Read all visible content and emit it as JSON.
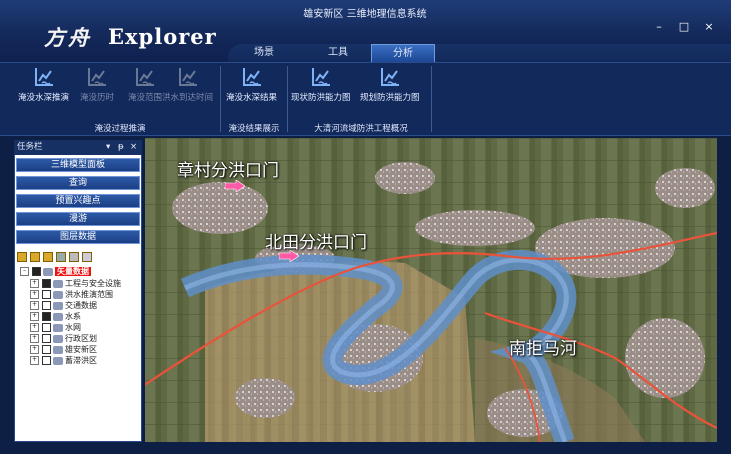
{
  "window": {
    "logo_mark": "方舟",
    "logo_word": "Explorer",
    "title": "雄安新区 三维地理信息系统",
    "controls": [
      "–",
      "□",
      "×"
    ]
  },
  "tabs": [
    {
      "label": "场景",
      "active": false
    },
    {
      "label": "工具",
      "active": false
    },
    {
      "label": "分析",
      "active": true
    }
  ],
  "ribbon": {
    "groups": [
      {
        "label": "淹没过程推演",
        "buttons": [
          {
            "label": "淹没水深推演",
            "enabled": true,
            "icon": "flood-chart-icon"
          },
          {
            "label": "淹没历时",
            "enabled": false,
            "icon": "flood-chart-icon"
          },
          {
            "label": "淹没范围",
            "enabled": false,
            "icon": "flood-chart-icon"
          },
          {
            "label": "洪水到达时间",
            "enabled": false,
            "icon": "flood-chart-icon"
          }
        ]
      },
      {
        "label": "淹没结果展示",
        "buttons": [
          {
            "label": "淹没水深结果",
            "enabled": true,
            "icon": "flood-chart-icon"
          }
        ]
      },
      {
        "label": "大清河流域防洪工程概况",
        "buttons": [
          {
            "label": "现状防洪能力图",
            "enabled": true,
            "icon": "flood-chart-icon"
          },
          {
            "label": "规划防洪能力图",
            "enabled": true,
            "icon": "flood-chart-icon"
          }
        ]
      }
    ]
  },
  "taskpanel": {
    "title": "任务栏",
    "header_icons": [
      "▾",
      "ᵽ",
      "×"
    ],
    "buttons": [
      "三维模型面板",
      "查询",
      "预置兴趣点",
      "漫游",
      "图层数据"
    ],
    "tree": {
      "root": "矢量数据",
      "items": [
        {
          "label": "工程与安全设施",
          "checked": true
        },
        {
          "label": "洪水推演范围",
          "checked": false
        },
        {
          "label": "交通数据",
          "checked": false
        },
        {
          "label": "水系",
          "checked": true
        },
        {
          "label": "水网",
          "checked": false
        },
        {
          "label": "行政区划",
          "checked": false
        },
        {
          "label": "雄安新区",
          "checked": false
        },
        {
          "label": "蓄滞洪区",
          "checked": false
        }
      ]
    }
  },
  "map": {
    "labels": [
      "章村分洪口门",
      "北田分洪口门",
      "南拒马河"
    ],
    "colors": {
      "river": "#5f8fc9",
      "boundary": "#e8533a",
      "gate_marker": "#ff5aa6"
    }
  }
}
